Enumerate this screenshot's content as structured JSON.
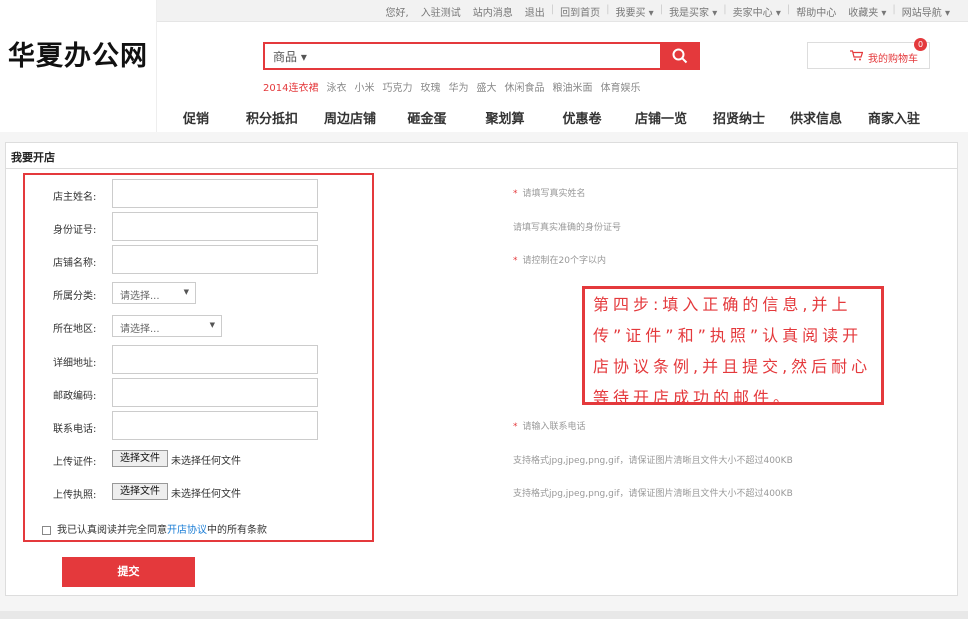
{
  "topbar": {
    "links": [
      "您好,",
      "入驻测试",
      "站内消息",
      "退出",
      "回到首页",
      "我要买 ▾",
      "我是买家 ▾",
      "卖家中心 ▾",
      "帮助中心",
      "收藏夹 ▾",
      "网站导航 ▾"
    ]
  },
  "logo": {
    "text": "华夏办公网"
  },
  "search": {
    "category": "商品 ▾",
    "placeholder": "",
    "icon": "search-icon"
  },
  "hotwords": [
    "2014连衣裙",
    "泳衣",
    "小米",
    "巧克力",
    "玫瑰",
    "华为",
    "盛大",
    "休闲食品",
    "粮油米面",
    "体育娱乐"
  ],
  "cart": {
    "label": "我的购物车",
    "count": "0"
  },
  "nav": [
    "促销",
    "积分抵扣",
    "周边店铺",
    "砸金蛋",
    "聚划算",
    "优惠卷",
    "店铺一览",
    "招贤纳士",
    "供求信息",
    "商家入驻"
  ],
  "panel": {
    "title": "我要开店"
  },
  "form": {
    "owner_name": {
      "label": "店主姓名:",
      "hint": "请填写真实姓名",
      "required": true
    },
    "id_number": {
      "label": "身份证号:",
      "hint": "请填写真实准确的身份证号",
      "required": false
    },
    "store_name": {
      "label": "店铺名称:",
      "hint": "请控制在20个字以内",
      "required": true
    },
    "category": {
      "label": "所属分类:",
      "value": "请选择..."
    },
    "region": {
      "label": "所在地区:",
      "value": "请选择..."
    },
    "address": {
      "label": "详细地址:"
    },
    "postcode": {
      "label": "邮政编码:"
    },
    "phone": {
      "label": "联系电话:",
      "hint": "请输入联系电话",
      "required": true
    },
    "id_upload": {
      "label": "上传证件:",
      "button": "选择文件",
      "status": "未选择任何文件",
      "hint": "支持格式jpg,jpeg,png,gif，请保证图片清晰且文件大小不超过400KB"
    },
    "license_upload": {
      "label": "上传执照:",
      "button": "选择文件",
      "status": "未选择任何文件",
      "hint": "支持格式jpg,jpeg,png,gif，请保证图片清晰且文件大小不超过400KB"
    },
    "agreement": {
      "prefix": "我已认真阅读并完全同意",
      "link": "开店协议",
      "suffix": "中的所有条款"
    },
    "submit_label": "提交"
  },
  "callout": {
    "text": "第四步:填入正确的信息,并上传”证件”和”执照”认真阅读开店协议条例,并且提交,然后耐心等待开店成功的邮件。"
  },
  "colors": {
    "accent": "#e4393c",
    "link": "#1a7dd6"
  }
}
